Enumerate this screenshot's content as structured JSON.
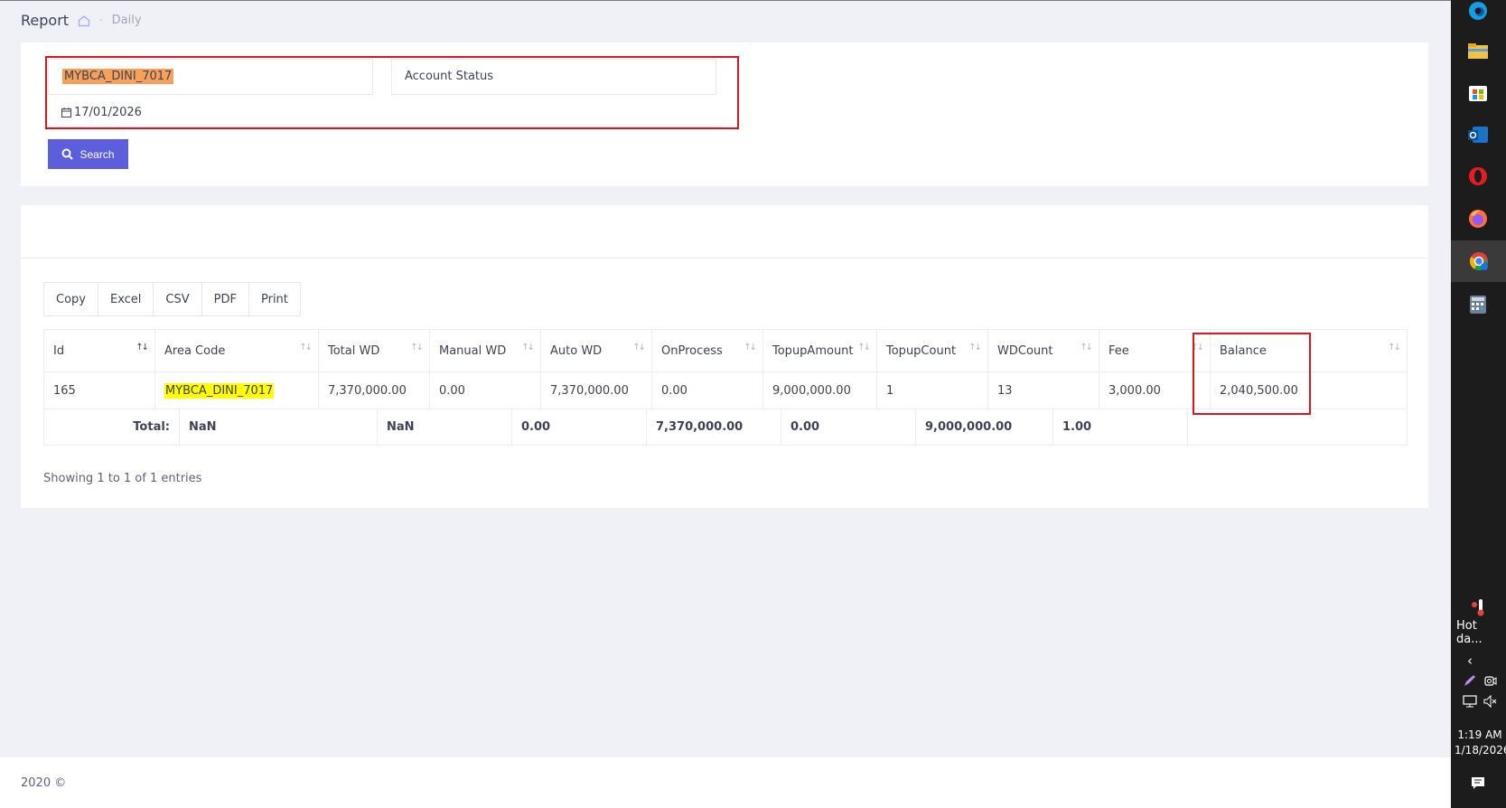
{
  "breadcrumb": {
    "title": "Report",
    "separator": "-",
    "current": "Daily"
  },
  "filters": {
    "area_code_value": "MYBCA_DINI_7017",
    "account_status_placeholder": "Account Status",
    "date_value": "17/01/2026",
    "search_label": "Search"
  },
  "export_buttons": [
    "Copy",
    "Excel",
    "CSV",
    "PDF",
    "Print"
  ],
  "table": {
    "columns": [
      "Id",
      "Area Code",
      "Total WD",
      "Manual WD",
      "Auto WD",
      "OnProcess",
      "TopupAmount",
      "TopupCount",
      "WDCount",
      "Fee",
      "Balance"
    ],
    "rows": [
      [
        "165",
        "MYBCA_DINI_7017",
        "7,370,000.00",
        "0.00",
        "7,370,000.00",
        "0.00",
        "9,000,000.00",
        "1",
        "13",
        "3,000.00",
        "2,040,500.00"
      ]
    ],
    "footer": [
      "Total:",
      "NaN",
      "NaN",
      "0.00",
      "7,370,000.00",
      "0.00",
      "9,000,000.00",
      "1.00",
      ""
    ]
  },
  "info": "Showing 1 to 1 of 1 entries",
  "footer_text": "2020 ©",
  "taskbar": {
    "weather": "Hot da...",
    "time": "1:19 AM",
    "date": "1/18/2026"
  },
  "colors": {
    "accent": "#5c5edc",
    "highlight_orange": "#f5a15b",
    "highlight_yellow": "#ffff00",
    "annotation_red": "#e0141e"
  }
}
